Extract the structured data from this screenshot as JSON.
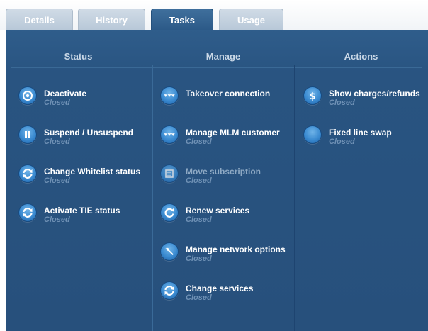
{
  "tabs": [
    {
      "label": "Details"
    },
    {
      "label": "History"
    },
    {
      "label": "Tasks"
    },
    {
      "label": "Usage"
    }
  ],
  "columns": {
    "status": {
      "header": "Status",
      "items": [
        {
          "title": "Deactivate",
          "status": "Closed",
          "icon": "power-icon"
        },
        {
          "title": "Suspend / Unsuspend",
          "status": "Closed",
          "icon": "pause-icon"
        },
        {
          "title": "Change Whitelist status",
          "status": "Closed",
          "icon": "refresh-icon"
        },
        {
          "title": "Activate TIE status",
          "status": "Closed",
          "icon": "refresh-icon"
        }
      ]
    },
    "manage": {
      "header": "Manage",
      "items": [
        {
          "title": "Takeover connection",
          "status": "",
          "icon": "stars-icon"
        },
        {
          "title": "Manage MLM customer",
          "status": "Closed",
          "icon": "stars-icon"
        },
        {
          "title": "Move subscription",
          "status": "Closed",
          "icon": "list-icon",
          "disabled": true
        },
        {
          "title": "Renew services",
          "status": "Closed",
          "icon": "renew-icon"
        },
        {
          "title": "Manage network options",
          "status": "Closed",
          "icon": "wrench-icon"
        },
        {
          "title": "Change services",
          "status": "Closed",
          "icon": "refresh-icon"
        }
      ]
    },
    "actions": {
      "header": "Actions",
      "items": [
        {
          "title": "Show charges/refunds",
          "status": "Closed",
          "icon": "dollar-icon"
        },
        {
          "title": "Fixed line swap",
          "status": "Closed",
          "icon": "blank-icon"
        }
      ]
    }
  }
}
